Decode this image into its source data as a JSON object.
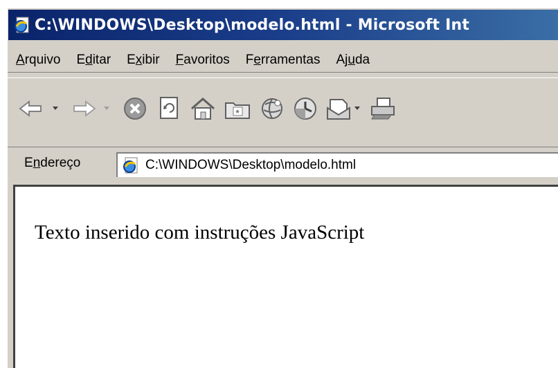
{
  "window": {
    "title": "C:\\WINDOWS\\Desktop\\modelo.html - Microsoft Int"
  },
  "menu": [
    {
      "label": "Arquivo",
      "accel": "A",
      "rest": "rquivo"
    },
    {
      "label": "Editar",
      "pre": "E",
      "accel": "d",
      "rest": "itar"
    },
    {
      "label": "Exibir",
      "pre": "E",
      "accel": "x",
      "rest": "ibir"
    },
    {
      "label": "Favoritos",
      "accel": "F",
      "rest": "avoritos"
    },
    {
      "label": "Ferramentas",
      "pre": "F",
      "accel": "e",
      "rest": "rramentas"
    },
    {
      "label": "Ajuda",
      "pre": "Aj",
      "accel": "u",
      "rest": "da"
    }
  ],
  "toolbar": {
    "icons": [
      "back-icon",
      "back-dropdown-icon",
      "forward-icon",
      "forward-dropdown-icon",
      "stop-icon",
      "refresh-icon",
      "home-icon",
      "search-folder-icon",
      "favorites-globe-icon",
      "history-icon",
      "mail-icon",
      "mail-dropdown-icon",
      "print-icon"
    ]
  },
  "address": {
    "label_pre": "E",
    "label_accel": "n",
    "label_rest": "dereço",
    "value": "C:\\WINDOWS\\Desktop\\modelo.html"
  },
  "page": {
    "text": "Texto inserido com instruções JavaScript"
  },
  "colors": {
    "titlebar_start": "#0a246a",
    "titlebar_end": "#3a6ea5",
    "chrome": "#d4d0c8"
  }
}
